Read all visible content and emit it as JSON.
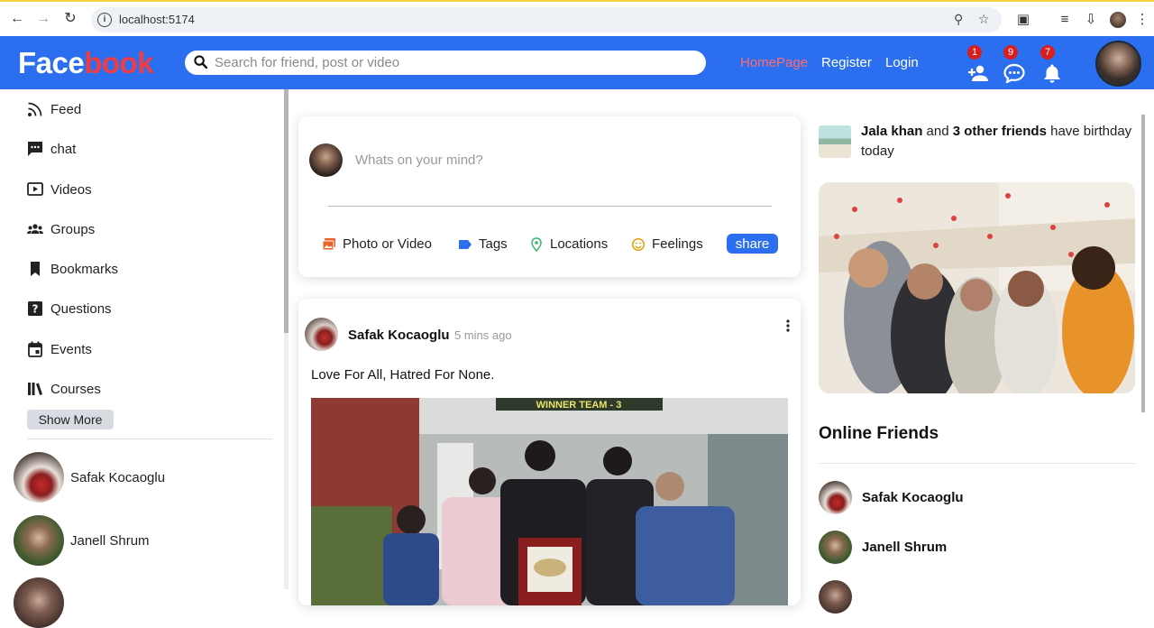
{
  "browser": {
    "url": "localhost:5174"
  },
  "header": {
    "logo_part1": "Face",
    "logo_part2": "book",
    "search_placeholder": "Search for friend, post or video",
    "links": [
      {
        "label": "HomePage",
        "active": true
      },
      {
        "label": "Register",
        "active": false
      },
      {
        "label": "Login",
        "active": false
      }
    ],
    "badges": {
      "friend_requests": "1",
      "messages": "9",
      "notifications": "7"
    }
  },
  "sidebar": {
    "items": [
      {
        "label": "Feed",
        "icon": "rss-feed-icon"
      },
      {
        "label": "chat",
        "icon": "chat-icon"
      },
      {
        "label": "Videos",
        "icon": "video-icon"
      },
      {
        "label": "Groups",
        "icon": "groups-icon"
      },
      {
        "label": "Bookmarks",
        "icon": "bookmark-icon"
      },
      {
        "label": "Questions",
        "icon": "question-icon"
      },
      {
        "label": "Events",
        "icon": "calendar-icon"
      },
      {
        "label": "Courses",
        "icon": "books-icon"
      }
    ],
    "show_more": "Show More",
    "friends": [
      {
        "name": "Safak Kocaoglu"
      },
      {
        "name": "Janell Shrum"
      }
    ]
  },
  "share": {
    "placeholder": "Whats on your mind?",
    "options": [
      {
        "label": "Photo or Video",
        "icon": "photo-icon",
        "color": "#e8632c"
      },
      {
        "label": "Tags",
        "icon": "label-icon",
        "color": "#2b6ff0"
      },
      {
        "label": "Locations",
        "icon": "location-icon",
        "color": "#3cb371"
      },
      {
        "label": "Feelings",
        "icon": "emoji-icon",
        "color": "#e0a000"
      }
    ],
    "button": "share"
  },
  "post": {
    "author": "Safak Kocaoglu",
    "time": "5 mins ago",
    "text": "Love For All, Hatred For None.",
    "image_banner": "WINNER TEAM - 3"
  },
  "rightbar": {
    "birthday": {
      "name": "Jala khan",
      "and": "and",
      "others": "3 other friends",
      "suffix": "have birthday today"
    },
    "online_title": "Online Friends",
    "online": [
      {
        "name": "Safak Kocaoglu"
      },
      {
        "name": "Janell Shrum"
      }
    ]
  },
  "colors": {
    "brand_blue": "#2b6ff0",
    "logo_red": "#f23c43",
    "active_link": "#ff6b6b",
    "badge_red": "#d81e1e"
  }
}
